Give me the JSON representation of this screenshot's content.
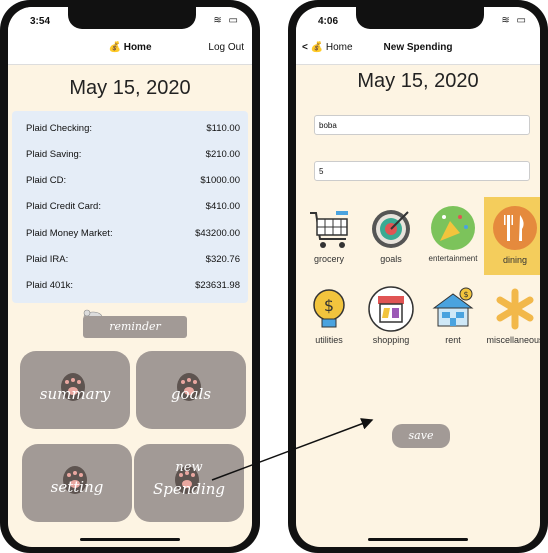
{
  "left": {
    "status_time": "3:54",
    "nav_title": "Home",
    "nav_right": "Log Out",
    "date": "May 15, 2020",
    "accounts": [
      {
        "name": "Plaid Checking:",
        "value": "$110.00"
      },
      {
        "name": "Plaid Saving:",
        "value": "$210.00"
      },
      {
        "name": "Plaid CD:",
        "value": "$1000.00"
      },
      {
        "name": "Plaid Credit Card:",
        "value": "$410.00"
      },
      {
        "name": "Plaid Money Market:",
        "value": "$43200.00"
      },
      {
        "name": "Plaid IRA:",
        "value": "$320.76"
      },
      {
        "name": "Plaid 401k:",
        "value": "$23631.98"
      }
    ],
    "reminder_label": "reminder",
    "buttons": {
      "summary": "summary",
      "goals": "goals",
      "setting": "setting",
      "new_spending_line1": "new",
      "new_spending_line2": "Spending"
    }
  },
  "right": {
    "status_time": "4:06",
    "back_label": "Home",
    "nav_title": "New Spending",
    "date": "May 15, 2020",
    "name_value": "boba",
    "amount_value": "5",
    "categories": [
      {
        "label": "grocery",
        "icon": "shopping-cart-icon"
      },
      {
        "label": "goals",
        "icon": "target-icon"
      },
      {
        "label": "entertainment",
        "icon": "confetti-icon"
      },
      {
        "label": "dining",
        "icon": "fork-knife-icon",
        "selected": true
      },
      {
        "label": "utilities",
        "icon": "lightbulb-icon"
      },
      {
        "label": "shopping",
        "icon": "store-icon"
      },
      {
        "label": "rent",
        "icon": "house-icon"
      },
      {
        "label": "miscellaneous",
        "icon": "asterisk-icon"
      }
    ],
    "save_label": "save"
  },
  "colors": {
    "screen_bg": "#fdf4e3",
    "button_gray": "#a29a96",
    "accounts_bg": "#e5edf7",
    "selected_highlight": "#f4cd5c"
  }
}
